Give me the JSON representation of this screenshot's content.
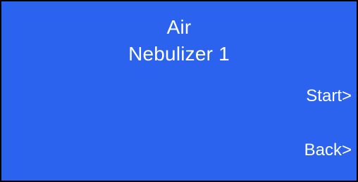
{
  "screen": {
    "background_color": "#2b63ef",
    "text_color": "#ffffff",
    "border_color": "#000000",
    "title_line1": "Air",
    "title_line2": "Nebulizer 1"
  },
  "softkeys": {
    "start_label": "Start>",
    "back_label": "Back>"
  }
}
